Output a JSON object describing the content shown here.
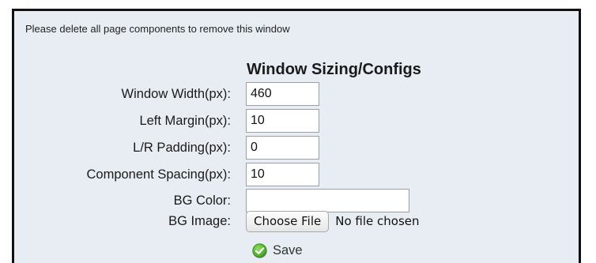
{
  "notice": "Please delete all page components to remove this window",
  "title": "Window Sizing/Configs",
  "fields": {
    "window_width": {
      "label": "Window Width(px):",
      "value": "460"
    },
    "left_margin": {
      "label": "Left Margin(px):",
      "value": "10"
    },
    "lr_padding": {
      "label": "L/R Padding(px):",
      "value": "0"
    },
    "component_spacing": {
      "label": "Component Spacing(px):",
      "value": "10"
    },
    "bg_color": {
      "label": "BG Color:",
      "value": ""
    },
    "bg_image": {
      "label": "BG Image:",
      "button_label": "Choose File",
      "status": "No file chosen"
    }
  },
  "save": {
    "label": "Save",
    "icon": "check-circle-icon",
    "icon_color": "#4caf2a"
  }
}
